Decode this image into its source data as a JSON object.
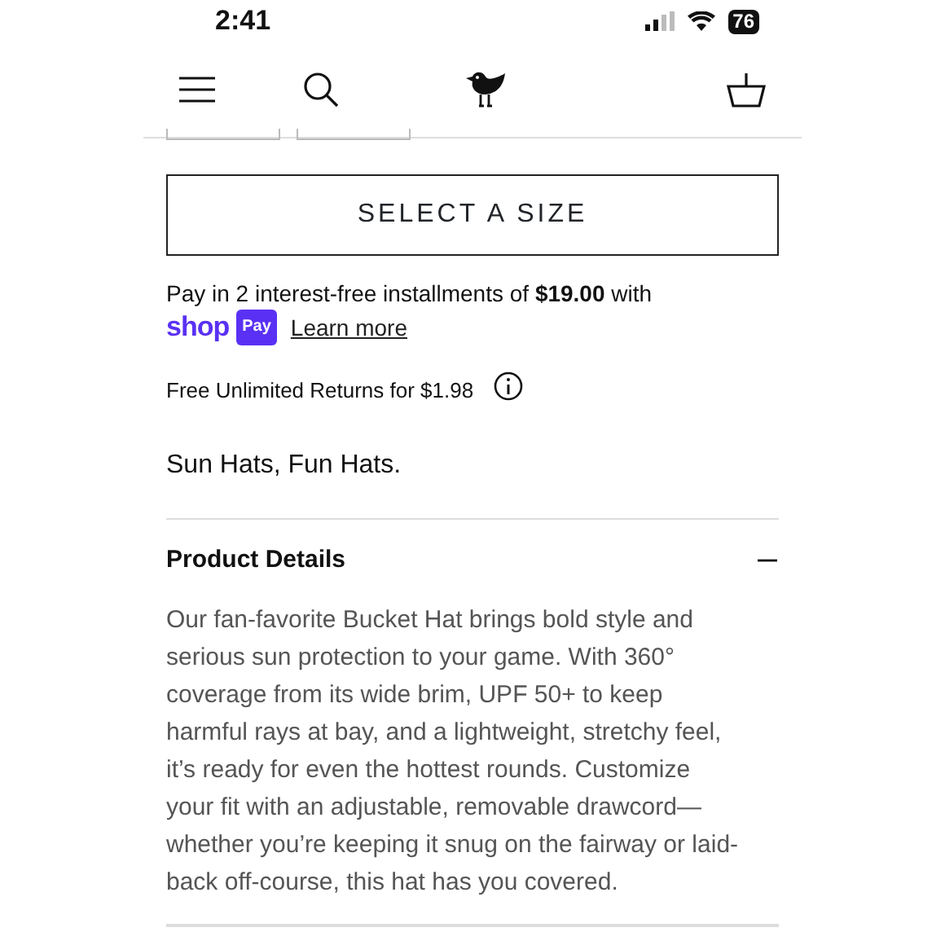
{
  "status_bar": {
    "time": "2:41",
    "battery": "76"
  },
  "size_button": {
    "label": "SELECT A SIZE"
  },
  "installments": {
    "text": "Pay in 2 interest-free installments of **$19.00** with",
    "brand": "shop",
    "brand_badge": "Pay",
    "link": "Learn more"
  },
  "returns": {
    "text": "Free Unlimited Returns for $1.98"
  },
  "tagline": "Sun Hats, Fun Hats.",
  "accordion": {
    "title": "Product Details",
    "expanded": true,
    "body": "Our fan-favorite Bucket Hat brings bold style and serious sun protection to your game. With 360° coverage from its wide brim, UPF 50+ to keep harmful rays at bay, and a lightweight, stretchy feel, it’s ready for even the hottest rounds. Customize your fit with an adjustable, removable drawcord—whether you’re keeping it snug on the fairway or laid-back off-course, this hat has you covered."
  }
}
